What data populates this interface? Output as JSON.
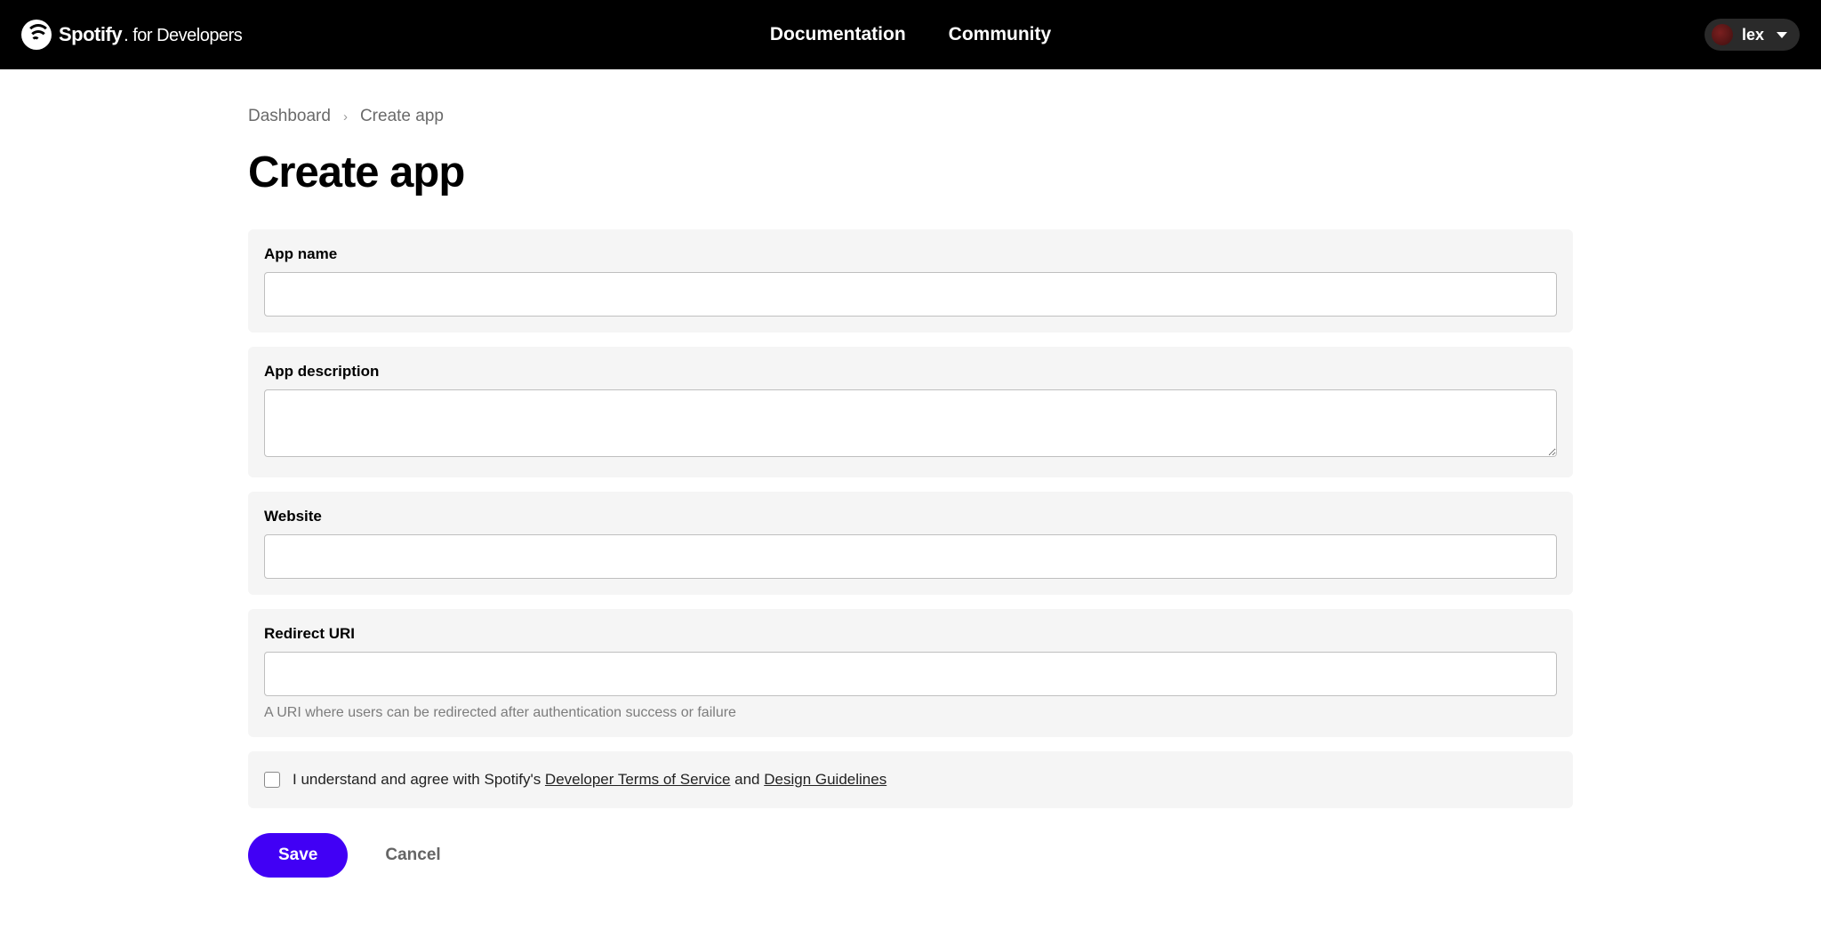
{
  "header": {
    "brand_main": "Spotify",
    "brand_sub": "for Developers",
    "nav": {
      "documentation": "Documentation",
      "community": "Community"
    },
    "user": {
      "name": "lex"
    }
  },
  "breadcrumb": {
    "dashboard": "Dashboard",
    "current": "Create app"
  },
  "page_title": "Create app",
  "form": {
    "app_name": {
      "label": "App name",
      "value": ""
    },
    "app_description": {
      "label": "App description",
      "value": ""
    },
    "website": {
      "label": "Website",
      "value": ""
    },
    "redirect_uri": {
      "label": "Redirect URI",
      "value": "",
      "help": "A URI where users can be redirected after authentication success or failure"
    },
    "agreement": {
      "prefix": "I understand and agree with Spotify's ",
      "tos_link": "Developer Terms of Service",
      "connector": " and ",
      "design_link": "Design Guidelines"
    }
  },
  "buttons": {
    "save": "Save",
    "cancel": "Cancel"
  }
}
